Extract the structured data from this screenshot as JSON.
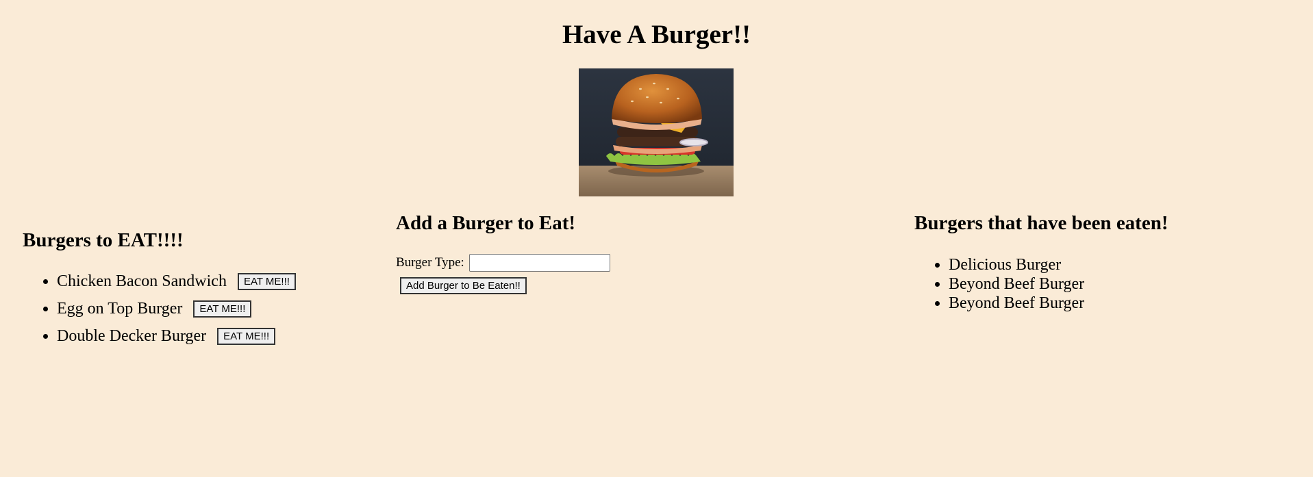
{
  "header": {
    "title": "Have A Burger!!"
  },
  "to_eat": {
    "heading": "Burgers to EAT!!!!",
    "items": [
      {
        "name": "Chicken Bacon Sandwich",
        "button": "EAT ME!!!"
      },
      {
        "name": "Egg on Top Burger",
        "button": "EAT ME!!!"
      },
      {
        "name": "Double Decker Burger",
        "button": "EAT ME!!!"
      }
    ]
  },
  "add_form": {
    "heading": "Add a Burger to Eat!",
    "label": "Burger Type:",
    "input_value": "",
    "button": "Add Burger to Be Eaten!!"
  },
  "eaten": {
    "heading": "Burgers that have been eaten!",
    "items": [
      "Delicious Burger",
      "Beyond Beef Burger",
      "Beyond Beef Burger"
    ]
  },
  "colors": {
    "background": "#faebd7"
  }
}
